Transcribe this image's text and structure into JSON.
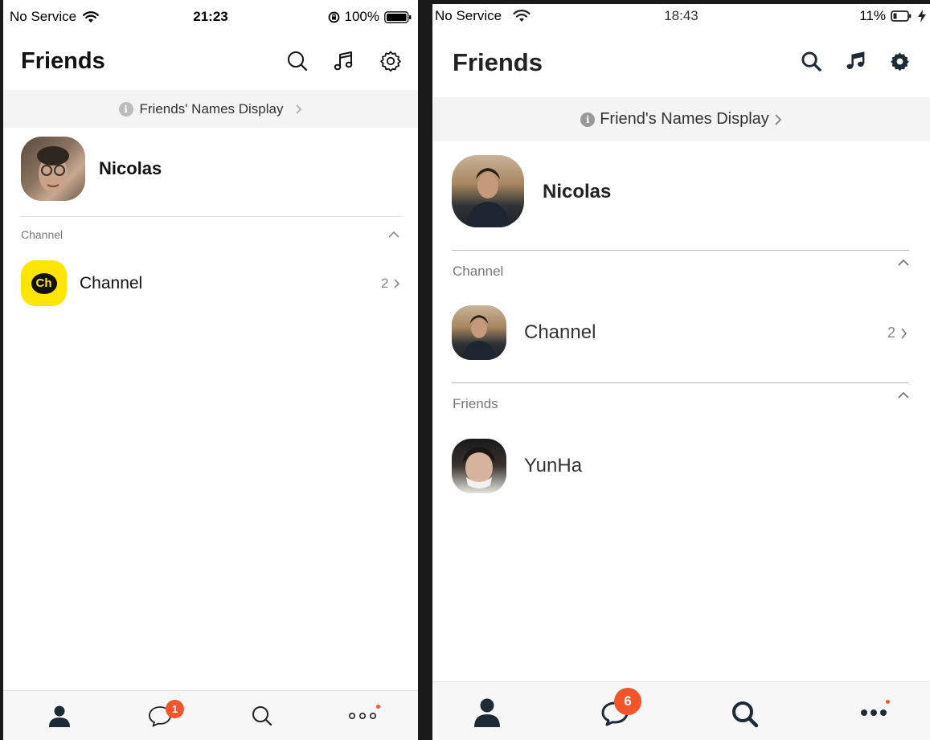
{
  "left": {
    "status": {
      "carrier": "No Service",
      "time": "21:23",
      "battery": "100%"
    },
    "title": "Friends",
    "banner": "Friends' Names Display",
    "profile": {
      "name": "Nicolas"
    },
    "channel_section": {
      "label": "Channel"
    },
    "channel_row": {
      "name": "Channel",
      "count": "2",
      "logo_text": "Ch"
    },
    "tabs": {
      "chat_badge": "1"
    }
  },
  "right": {
    "status": {
      "carrier": "No Service",
      "time": "18:43",
      "battery": "11%"
    },
    "title": "Friends",
    "banner": "Friend's Names Display",
    "profile": {
      "name": "Nicolas"
    },
    "channel_section": {
      "label": "Channel"
    },
    "channel_row": {
      "name": "Channel",
      "count": "2"
    },
    "friends_section": {
      "label": "Friends"
    },
    "friend_row": {
      "name": "YunHa"
    },
    "tabs": {
      "chat_badge": "6"
    }
  },
  "colors": {
    "badge": "#f2552c",
    "channel_logo": "#fee500",
    "banner_bg": "#f4f4f4"
  },
  "icons": [
    "wifi-icon",
    "battery-icon",
    "rotation-lock-icon",
    "charging-icon",
    "search-icon",
    "music-icon",
    "gear-icon",
    "info-icon",
    "chevron-right-icon",
    "chevron-up-icon",
    "person-icon",
    "chat-bubble-icon",
    "more-icon"
  ]
}
